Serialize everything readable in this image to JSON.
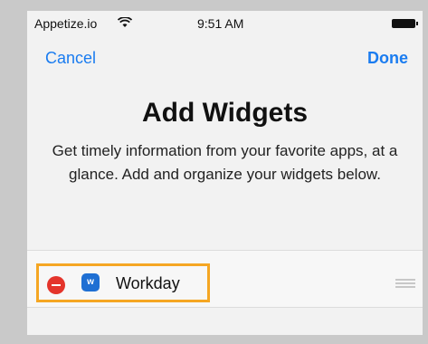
{
  "status": {
    "carrier": "Appetize.io",
    "time": "9:51 AM",
    "wifi_icon": "wifi-icon",
    "battery_icon": "battery-icon"
  },
  "nav": {
    "cancel_label": "Cancel",
    "done_label": "Done"
  },
  "header": {
    "title": "Add Widgets",
    "subtitle": "Get timely information from your favorite apps, at a glance. Add and organize your widgets below."
  },
  "widgets": [
    {
      "name": "Workday",
      "icon": "workday-app-icon",
      "remove_icon": "remove-minus-icon",
      "reorder_icon": "reorder-handle-icon"
    }
  ],
  "colors": {
    "accent": "#1a7cf0",
    "remove": "#e4342b",
    "highlight": "#f5a623",
    "app_icon": "#1e6fd3"
  }
}
